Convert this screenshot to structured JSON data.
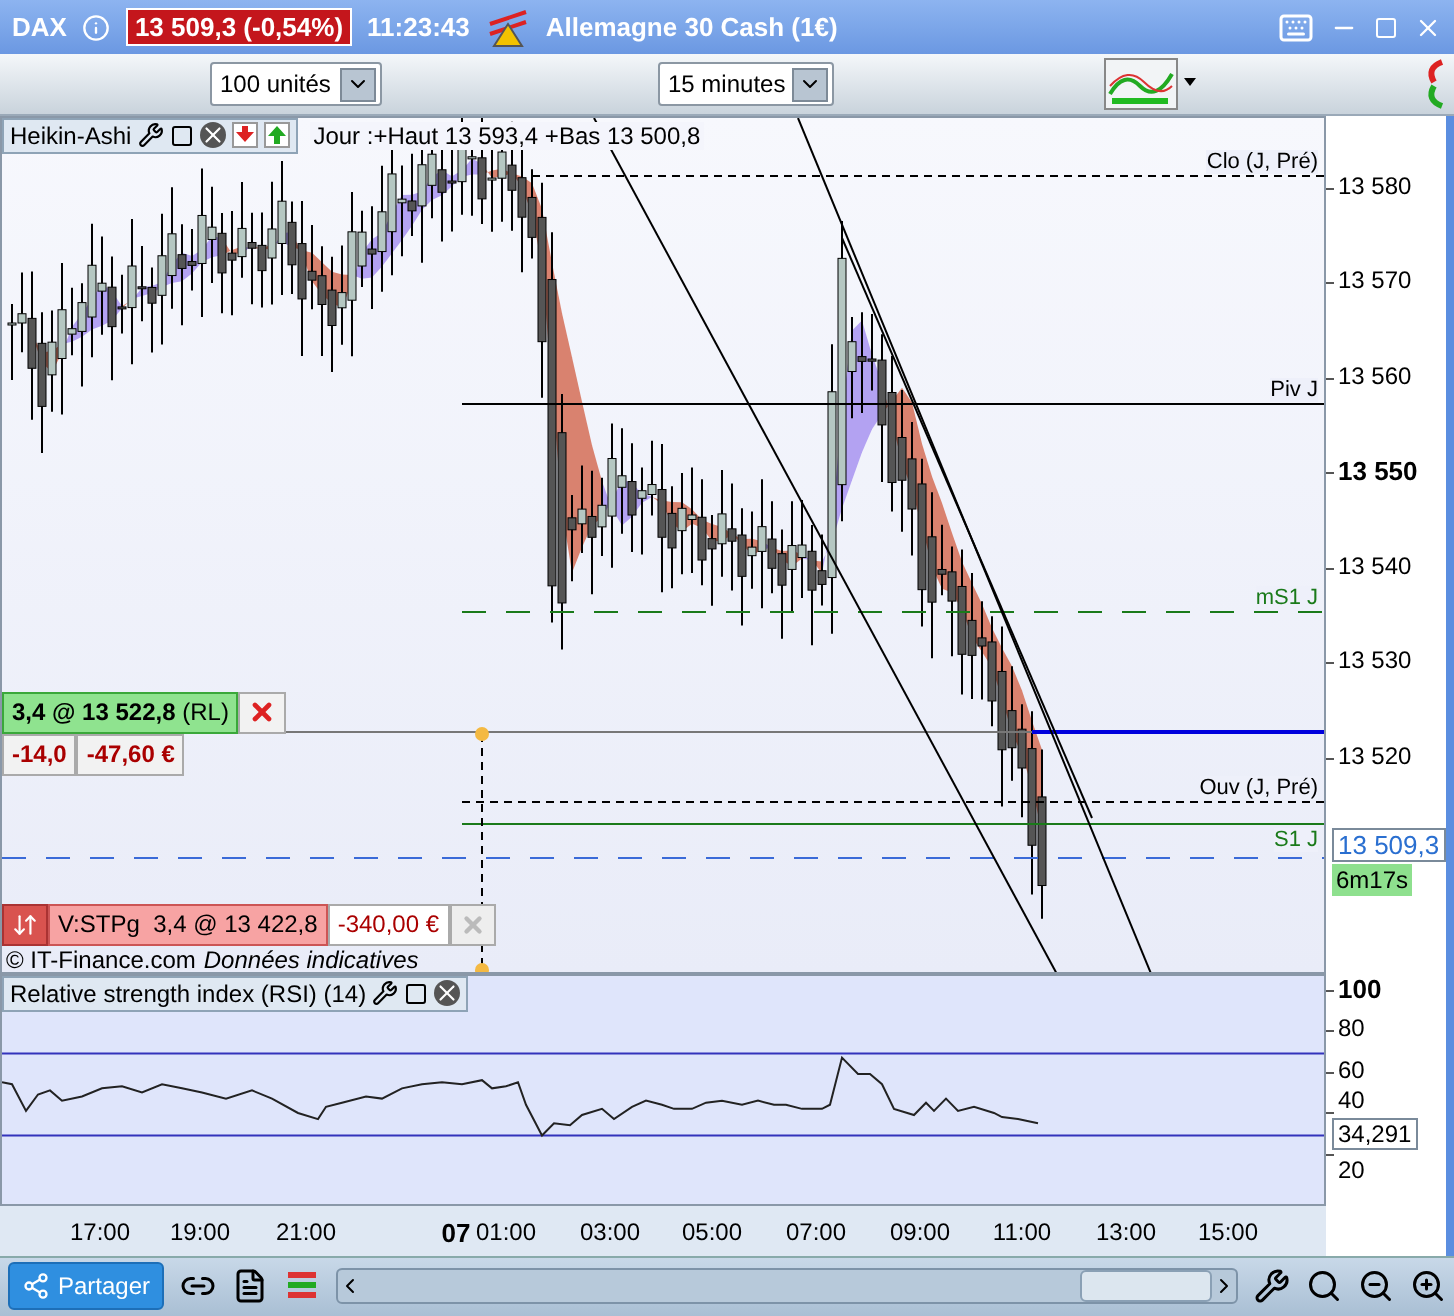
{
  "title_bar": {
    "instrument": "DAX",
    "price": "13 509,3 (-0,54%)",
    "time": "11:23:43",
    "name": "Allemagne 30 Cash (1€)"
  },
  "toolbar": {
    "quantity": "100 unités",
    "interval": "15 minutes"
  },
  "price_chart": {
    "indicator": "Heikin-Ashi",
    "day_info": "Jour :+Haut 13 593,4 +Bas 13 500,8",
    "levels": [
      {
        "label": "Clo (J, Pré)",
        "kind": "dashed",
        "color": "#000000"
      },
      {
        "label": "Piv J",
        "kind": "solid",
        "color": "#000000"
      },
      {
        "label": "mS1 J",
        "kind": "longdash",
        "color": "#1a7a1a"
      },
      {
        "label": "Ouv (J, Pré)",
        "kind": "dashed",
        "color": "#000000"
      },
      {
        "label": "S1 J",
        "kind": "solid",
        "color": "#1a7a1a"
      }
    ],
    "order": {
      "text": "3,4 @ 13 522,8",
      "tag": "(RL)",
      "points": "-14,0",
      "pnl": "-47,60 €"
    },
    "stop": {
      "text": "V:STPg  3,4 @ 13 422,8",
      "pnl": "-340,00 €"
    },
    "copyright": "© IT-Finance.com",
    "disclaimer": "Données indicatives",
    "y_ticks": [
      {
        "label": "13 580",
        "major": false
      },
      {
        "label": "13 570",
        "major": false
      },
      {
        "label": "13 560",
        "major": false
      },
      {
        "label": "13 550",
        "major": true
      },
      {
        "label": "13 540",
        "major": false
      },
      {
        "label": "13 530",
        "major": false
      },
      {
        "label": "13 520",
        "major": false
      }
    ],
    "last_price": "13 509,3",
    "countdown": "6m17s"
  },
  "rsi": {
    "title": "Relative strength index (RSI) (14)",
    "value": "34,291",
    "y_ticks": [
      {
        "label": "100",
        "major": true
      },
      {
        "label": "80",
        "major": false
      },
      {
        "label": "60",
        "major": false
      },
      {
        "label": "40",
        "major": false
      },
      {
        "label": "20",
        "major": false
      }
    ]
  },
  "x_ticks": [
    {
      "label": "17:00",
      "major": false
    },
    {
      "label": "19:00",
      "major": false
    },
    {
      "label": "21:00",
      "major": false
    },
    {
      "label": "07",
      "major": true
    },
    {
      "label": "01:00",
      "major": false
    },
    {
      "label": "03:00",
      "major": false
    },
    {
      "label": "05:00",
      "major": false
    },
    {
      "label": "07:00",
      "major": false
    },
    {
      "label": "09:00",
      "major": false
    },
    {
      "label": "11:00",
      "major": false
    },
    {
      "label": "13:00",
      "major": false
    },
    {
      "label": "15:00",
      "major": false
    }
  ],
  "bottom_bar": {
    "share": "Partager"
  }
}
